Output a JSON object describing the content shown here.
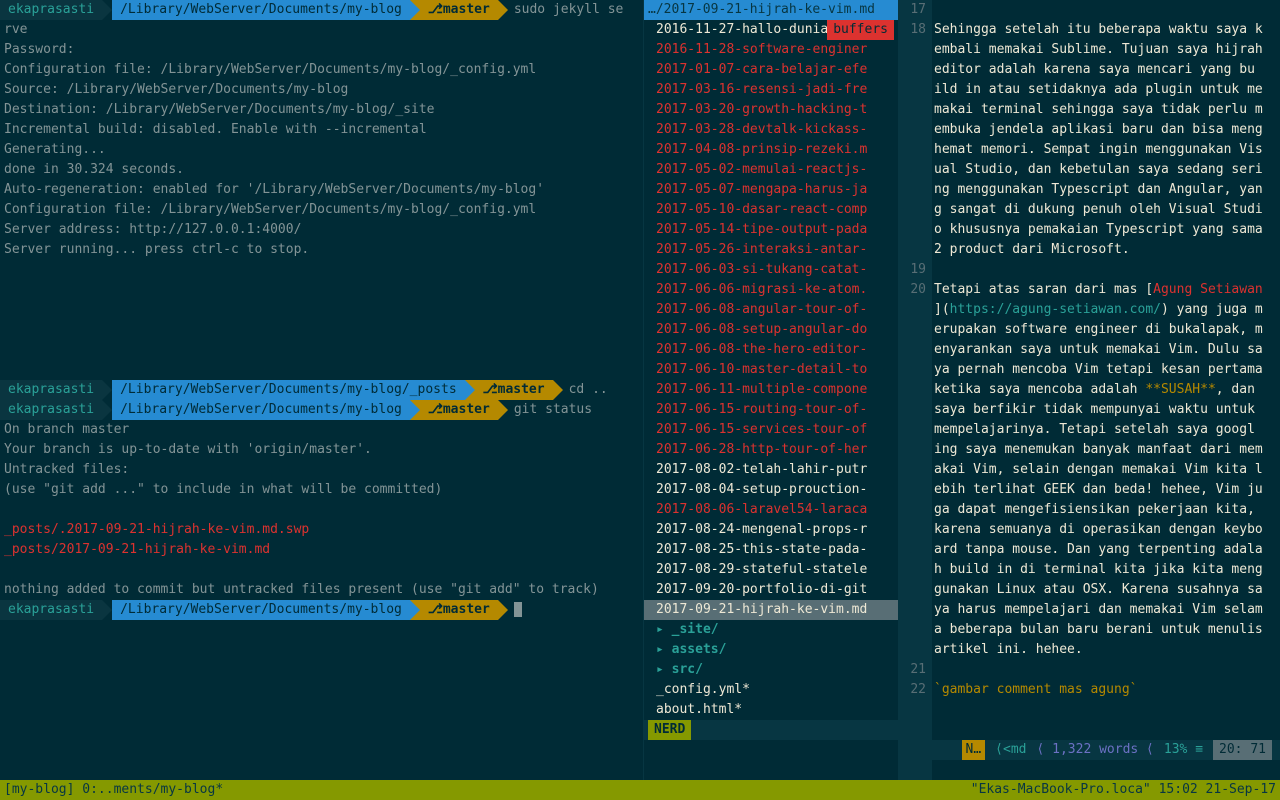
{
  "left": {
    "prompts": [
      {
        "user": "ekaprasasti",
        "path": "/Library/WebServer/Documents/my-blog",
        "branch": "master",
        "cmd": "sudo jekyll se",
        "cmdCont": "rve"
      },
      {
        "user": "ekaprasasti",
        "path": "/Library/WebServer/Documents/my-blog/_posts",
        "branch": "master",
        "cmd": "cd .."
      },
      {
        "user": "ekaprasasti",
        "path": "/Library/WebServer/Documents/my-blog",
        "branch": "master",
        "cmd": "git status"
      },
      {
        "user": "ekaprasasti",
        "path": "/Library/WebServer/Documents/my-blog",
        "branch": "master",
        "cmd": ""
      }
    ],
    "jekyll_output": [
      "Password:",
      "Configuration file: /Library/WebServer/Documents/my-blog/_config.yml",
      "            Source: /Library/WebServer/Documents/my-blog",
      "       Destination: /Library/WebServer/Documents/my-blog/_site",
      " Incremental build: disabled. Enable with --incremental",
      "      Generating...",
      "                    done in 30.324 seconds.",
      " Auto-regeneration: enabled for '/Library/WebServer/Documents/my-blog'",
      "Configuration file: /Library/WebServer/Documents/my-blog/_config.yml",
      "    Server address: http://127.0.0.1:4000/",
      "  Server running... press ctrl-c to stop."
    ],
    "git_output": [
      {
        "t": "On branch master",
        "c": ""
      },
      {
        "t": "Your branch is up-to-date with 'origin/master'.",
        "c": ""
      },
      {
        "t": "Untracked files:",
        "c": ""
      },
      {
        "t": "  (use \"git add <file>...\" to include in what will be committed)",
        "c": ""
      },
      {
        "t": "",
        "c": ""
      },
      {
        "t": "        _posts/.2017-09-21-hijrah-ke-vim.md.swp",
        "c": "red"
      },
      {
        "t": "        _posts/2017-09-21-hijrah-ke-vim.md",
        "c": "red"
      },
      {
        "t": "",
        "c": ""
      },
      {
        "t": "nothing added to commit but untracked files present (use \"git add\" to track)",
        "c": ""
      }
    ]
  },
  "nerdtree": {
    "header": "…/2017-09-21-hijrah-ke-vim.md",
    "buffers": "buffers",
    "files": [
      {
        "n": "2016-11-27-hallo-dunia.md",
        "c": "white"
      },
      {
        "n": "2016-11-28-software-enginer",
        "c": "red"
      },
      {
        "n": "2017-01-07-cara-belajar-efe",
        "c": "red"
      },
      {
        "n": "2017-03-16-resensi-jadi-fre",
        "c": "red"
      },
      {
        "n": "2017-03-20-growth-hacking-t",
        "c": "red"
      },
      {
        "n": "2017-03-28-devtalk-kickass-",
        "c": "red"
      },
      {
        "n": "2017-04-08-prinsip-rezeki.m",
        "c": "red"
      },
      {
        "n": "2017-05-02-memulai-reactjs-",
        "c": "red"
      },
      {
        "n": "2017-05-07-mengapa-harus-ja",
        "c": "red"
      },
      {
        "n": "2017-05-10-dasar-react-comp",
        "c": "red"
      },
      {
        "n": "2017-05-14-tipe-output-pada",
        "c": "red"
      },
      {
        "n": "2017-05-26-interaksi-antar-",
        "c": "red"
      },
      {
        "n": "2017-06-03-si-tukang-catat-",
        "c": "red"
      },
      {
        "n": "2017-06-06-migrasi-ke-atom.",
        "c": "red"
      },
      {
        "n": "2017-06-08-angular-tour-of-",
        "c": "red"
      },
      {
        "n": "2017-06-08-setup-angular-do",
        "c": "red"
      },
      {
        "n": "2017-06-08-the-hero-editor-",
        "c": "red"
      },
      {
        "n": "2017-06-10-master-detail-to",
        "c": "red"
      },
      {
        "n": "2017-06-11-multiple-compone",
        "c": "red"
      },
      {
        "n": "2017-06-15-routing-tour-of-",
        "c": "red"
      },
      {
        "n": "2017-06-15-services-tour-of",
        "c": "red"
      },
      {
        "n": "2017-06-28-http-tour-of-her",
        "c": "red"
      },
      {
        "n": "2017-08-02-telah-lahir-putr",
        "c": "white"
      },
      {
        "n": "2017-08-04-setup-prouction-",
        "c": "white"
      },
      {
        "n": "2017-08-06-laravel54-laraca",
        "c": "red"
      },
      {
        "n": "2017-08-24-mengenal-props-r",
        "c": "white"
      },
      {
        "n": "2017-08-25-this-state-pada-",
        "c": "white"
      },
      {
        "n": "2017-08-29-stateful-statele",
        "c": "white"
      },
      {
        "n": "2017-09-20-portfolio-di-git",
        "c": "white"
      },
      {
        "n": "2017-09-21-hijrah-ke-vim.md",
        "c": "selected"
      }
    ],
    "dirs": [
      "_site/",
      "assets/",
      "src/"
    ],
    "bottom_files": [
      "_config.yml*",
      "about.html*"
    ],
    "status_left": "NERD"
  },
  "editor": {
    "line_nums": [
      "17",
      "18",
      "",
      "",
      "",
      "",
      "",
      "",
      "",
      "",
      "",
      "",
      "",
      "19",
      "20",
      "",
      "",
      "",
      "",
      "",
      "",
      "",
      "",
      "",
      "",
      "",
      "",
      "",
      "",
      "",
      "",
      "",
      "",
      "21",
      "22"
    ],
    "lines": [
      {
        "segs": [
          {
            "t": "",
            "c": "md-text"
          }
        ]
      },
      {
        "segs": [
          {
            "t": "Sehingga setelah itu beberapa waktu saya k",
            "c": "md-text"
          }
        ]
      },
      {
        "segs": [
          {
            "t": "embali memakai Sublime. Tujuan saya hijrah",
            "c": "md-text"
          }
        ]
      },
      {
        "segs": [
          {
            "t": " editor adalah karena saya mencari yang bu",
            "c": "md-text"
          }
        ]
      },
      {
        "segs": [
          {
            "t": "ild in atau setidaknya ada plugin untuk me",
            "c": "md-text"
          }
        ]
      },
      {
        "segs": [
          {
            "t": "makai terminal sehingga saya tidak perlu m",
            "c": "md-text"
          }
        ]
      },
      {
        "segs": [
          {
            "t": "embuka jendela aplikasi baru dan bisa meng",
            "c": "md-text"
          }
        ]
      },
      {
        "segs": [
          {
            "t": "hemat memori. Sempat ingin menggunakan Vis",
            "c": "md-text"
          }
        ]
      },
      {
        "segs": [
          {
            "t": "ual Studio, dan kebetulan saya sedang seri",
            "c": "md-text"
          }
        ]
      },
      {
        "segs": [
          {
            "t": "ng menggunakan Typescript dan Angular, yan",
            "c": "md-text"
          }
        ]
      },
      {
        "segs": [
          {
            "t": "g sangat di dukung penuh oleh Visual Studi",
            "c": "md-text"
          }
        ]
      },
      {
        "segs": [
          {
            "t": "o khususnya pemakaian Typescript yang sama",
            "c": "md-text"
          }
        ]
      },
      {
        "segs": [
          {
            "t": "2 product dari Microsoft.",
            "c": "md-text"
          }
        ]
      },
      {
        "segs": [
          {
            "t": "",
            "c": "md-text"
          }
        ]
      },
      {
        "segs": [
          {
            "t": "Tetapi atas saran dari mas [",
            "c": "md-text"
          },
          {
            "t": "Agung Setiawan",
            "c": "md-link-text"
          }
        ]
      },
      {
        "segs": [
          {
            "t": "](",
            "c": "md-text"
          },
          {
            "t": "https://agung-setiawan.com/",
            "c": "md-link-url"
          },
          {
            "t": ") yang juga m",
            "c": "md-text"
          }
        ]
      },
      {
        "segs": [
          {
            "t": "erupakan software engineer di bukalapak, m",
            "c": "md-text"
          }
        ]
      },
      {
        "segs": [
          {
            "t": "enyarankan saya untuk memakai Vim. Dulu sa",
            "c": "md-text"
          }
        ]
      },
      {
        "segs": [
          {
            "t": "ya pernah mencoba Vim tetapi kesan pertama",
            "c": "md-text"
          }
        ]
      },
      {
        "segs": [
          {
            "t": " ketika saya mencoba adalah ",
            "c": "md-text"
          },
          {
            "t": "**SUSAH**",
            "c": "md-bold"
          },
          {
            "t": ", dan",
            "c": "md-text"
          }
        ]
      },
      {
        "segs": [
          {
            "t": " saya berfikir tidak mempunyai waktu untuk",
            "c": "md-text"
          }
        ]
      },
      {
        "segs": [
          {
            "t": " mempelajarinya. Tetapi setelah saya googl",
            "c": "md-text"
          }
        ]
      },
      {
        "segs": [
          {
            "t": "ing saya menemukan banyak manfaat dari mem",
            "c": "md-text"
          }
        ]
      },
      {
        "segs": [
          {
            "t": "akai Vim, selain dengan memakai Vim kita l",
            "c": "md-text"
          }
        ]
      },
      {
        "segs": [
          {
            "t": "ebih terlihat GEEK dan beda! hehee, Vim ju",
            "c": "md-text"
          }
        ]
      },
      {
        "segs": [
          {
            "t": "ga dapat mengefisiensikan pekerjaan kita, ",
            "c": "md-text"
          }
        ]
      },
      {
        "segs": [
          {
            "t": "karena semuanya di operasikan dengan keybo",
            "c": "md-text"
          }
        ]
      },
      {
        "segs": [
          {
            "t": "ard tanpa mouse. Dan yang terpenting adala",
            "c": "md-text"
          }
        ]
      },
      {
        "segs": [
          {
            "t": "h build in di terminal kita jika kita meng",
            "c": "md-text"
          }
        ]
      },
      {
        "segs": [
          {
            "t": "gunakan Linux atau OSX. Karena susahnya sa",
            "c": "md-text"
          }
        ]
      },
      {
        "segs": [
          {
            "t": "ya harus mempelajari dan memakai Vim selam",
            "c": "md-text"
          }
        ]
      },
      {
        "segs": [
          {
            "t": "a beberapa bulan baru berani untuk menulis",
            "c": "md-text"
          }
        ]
      },
      {
        "segs": [
          {
            "t": " artikel ini. hehee.",
            "c": "md-text"
          }
        ]
      },
      {
        "segs": [
          {
            "t": "",
            "c": "md-text"
          }
        ]
      },
      {
        "segs": [
          {
            "t": "`gambar comment mas agung`",
            "c": "md-code"
          }
        ]
      }
    ],
    "status": {
      "mode": "N…",
      "ft": "<md",
      "words": "1,322 words",
      "pct": "13%",
      "pos": "20: 71"
    }
  },
  "tmux": {
    "left": "[my-blog] 0:..ments/my-blog*",
    "right": "\"Ekas-MacBook-Pro.loca\" 15:02 21-Sep-17"
  }
}
